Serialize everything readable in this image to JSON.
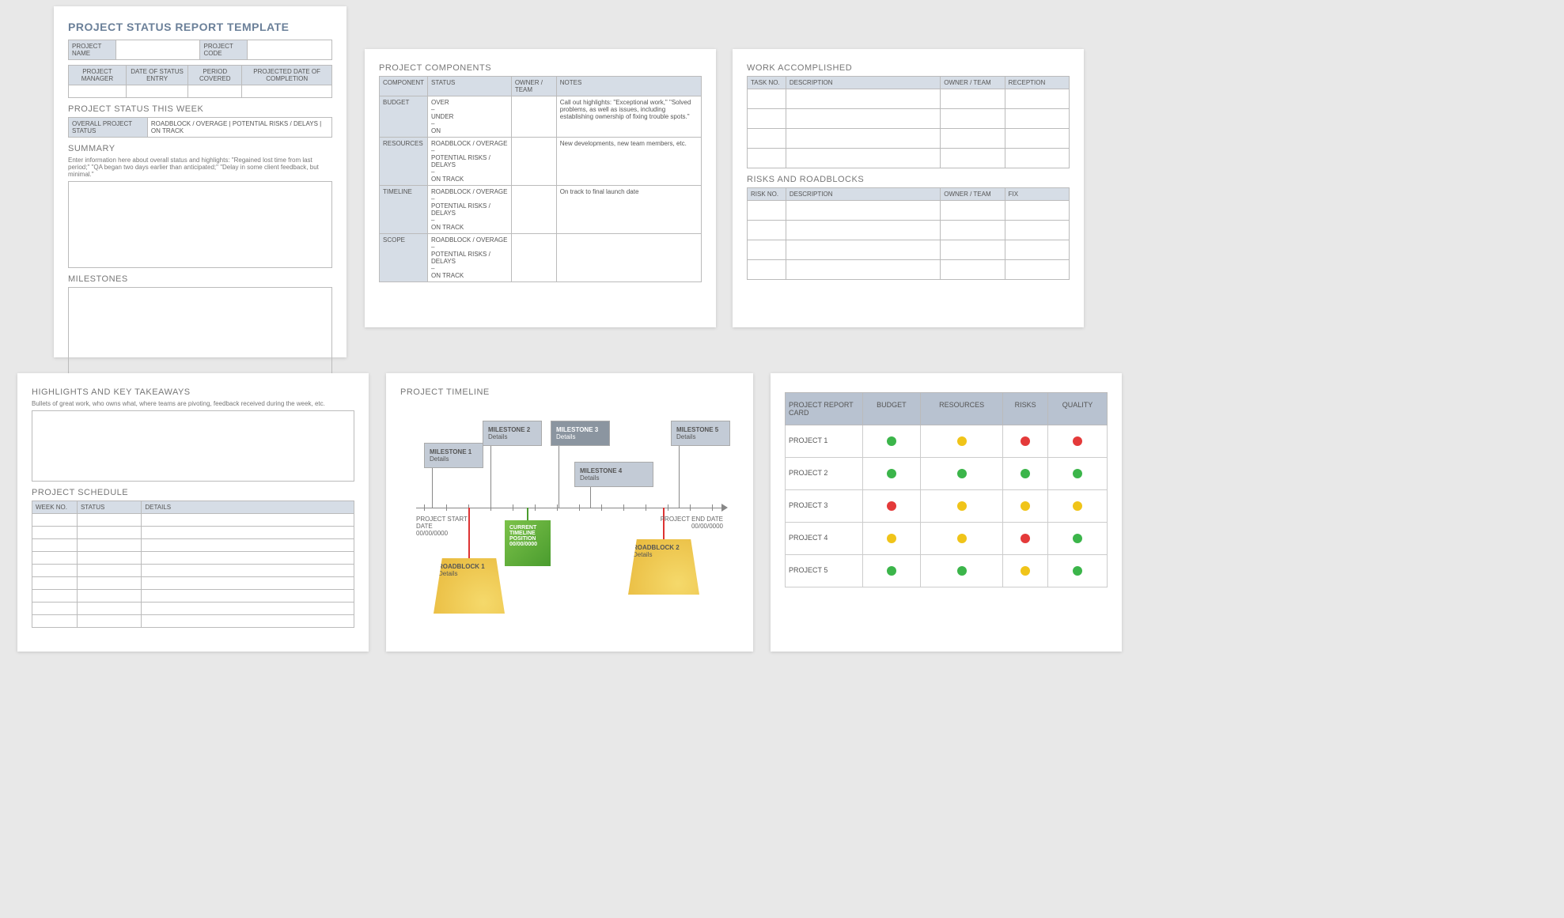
{
  "page1": {
    "title": "PROJECT STATUS REPORT TEMPLATE",
    "proj_name_lbl": "PROJECT NAME",
    "proj_code_lbl": "PROJECT CODE",
    "hdr": [
      "PROJECT MANAGER",
      "DATE OF STATUS ENTRY",
      "PERIOD COVERED",
      "PROJECTED DATE OF COMPLETION"
    ],
    "status_title": "PROJECT STATUS THIS WEEK",
    "overall_lbl": "OVERALL PROJECT STATUS",
    "status_opts": "ROADBLOCK / OVERAGE    |    POTENTIAL RISKS / DELAYS    |    ON TRACK",
    "summary_title": "SUMMARY",
    "summary_hint": "Enter information here about overall status and highlights: \"Regained lost time from last period;\" \"QA began two days earlier than anticipated;\" \"Delay in some client feedback, but minimal.\"",
    "milestones_title": "MILESTONES"
  },
  "page2": {
    "title": "PROJECT COMPONENTS",
    "hdr": [
      "COMPONENT",
      "STATUS",
      "OWNER / TEAM",
      "NOTES"
    ],
    "rows": [
      {
        "comp": "BUDGET",
        "status": "OVER\n–\nUNDER\n–\nON",
        "notes": "Call out highlights: \"Exceptional work,\" \"Solved problems, as well as issues, including establishing ownership of fixing trouble spots.\""
      },
      {
        "comp": "RESOURCES",
        "status": "ROADBLOCK / OVERAGE\n–\nPOTENTIAL RISKS / DELAYS\n–\nON TRACK",
        "notes": "New developments, new team members, etc."
      },
      {
        "comp": "TIMELINE",
        "status": "ROADBLOCK / OVERAGE\n–\nPOTENTIAL RISKS / DELAYS\n–\nON TRACK",
        "notes": "On track to final launch date"
      },
      {
        "comp": "SCOPE",
        "status": "ROADBLOCK / OVERAGE\n–\nPOTENTIAL RISKS / DELAYS\n–\nON TRACK",
        "notes": ""
      }
    ]
  },
  "page3": {
    "work_title": "WORK ACCOMPLISHED",
    "work_hdr": [
      "TASK NO.",
      "DESCRIPTION",
      "OWNER / TEAM",
      "RECEPTION"
    ],
    "risks_title": "RISKS AND ROADBLOCKS",
    "risks_hdr": [
      "RISK NO.",
      "DESCRIPTION",
      "OWNER / TEAM",
      "FIX"
    ]
  },
  "page4": {
    "hl_title": "HIGHLIGHTS AND KEY TAKEAWAYS",
    "hl_hint": "Bullets of great work, who owns what, where teams are pivoting, feedback received during the week, etc.",
    "sched_title": "PROJECT SCHEDULE",
    "sched_hdr": [
      "WEEK NO.",
      "STATUS",
      "DETAILS"
    ]
  },
  "page5": {
    "title": "PROJECT TIMELINE",
    "start_lbl": "PROJECT START DATE",
    "start_date": "00/00/0000",
    "end_lbl": "PROJECT END DATE",
    "end_date": "00/00/0000",
    "cur_lbl": "CURRENT TIMELINE POSITION",
    "cur_date": "00/00/0000",
    "milestones": [
      {
        "t": "MILESTONE 1",
        "d": "Details"
      },
      {
        "t": "MILESTONE 2",
        "d": "Details"
      },
      {
        "t": "MILESTONE 3",
        "d": "Details"
      },
      {
        "t": "MILESTONE 4",
        "d": "Details"
      },
      {
        "t": "MILESTONE 5",
        "d": "Details"
      }
    ],
    "roadblocks": [
      {
        "t": "ROADBLOCK 1",
        "d": "Details"
      },
      {
        "t": "ROADBLOCK 2",
        "d": "Details"
      }
    ]
  },
  "page6": {
    "card_lbl": "PROJECT REPORT CARD",
    "hdr": [
      "BUDGET",
      "RESOURCES",
      "RISKS",
      "QUALITY"
    ],
    "rows": [
      {
        "name": "PROJECT 1",
        "v": [
          "g",
          "y",
          "r",
          "r"
        ]
      },
      {
        "name": "PROJECT 2",
        "v": [
          "g",
          "g",
          "g",
          "g"
        ]
      },
      {
        "name": "PROJECT 3",
        "v": [
          "r",
          "y",
          "y",
          "y"
        ]
      },
      {
        "name": "PROJECT 4",
        "v": [
          "y",
          "y",
          "r",
          "g"
        ]
      },
      {
        "name": "PROJECT 5",
        "v": [
          "g",
          "g",
          "y",
          "g"
        ]
      }
    ]
  }
}
